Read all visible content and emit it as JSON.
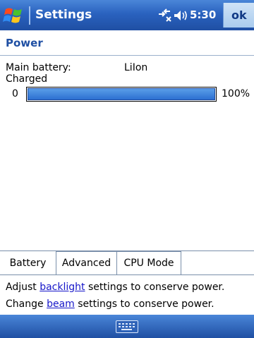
{
  "titlebar": {
    "title": "Settings",
    "time": "5:30",
    "ok": "ok"
  },
  "header": "Power",
  "battery": {
    "main_label": "Main battery:",
    "type": "LiIon",
    "status": "Charged",
    "min_label": "0",
    "max_label": "100%",
    "level_fraction": 1.0
  },
  "tabs": [
    {
      "label": "Battery"
    },
    {
      "label": "Advanced"
    },
    {
      "label": "CPU Mode"
    }
  ],
  "help": {
    "line1_prefix": "Adjust ",
    "line1_link": "backlight",
    "line1_suffix": " settings to conserve power.",
    "line2_prefix": "Change ",
    "line2_link": "beam",
    "line2_suffix": " settings to conserve power."
  },
  "icons": {
    "start": "windows-flag-icon",
    "connectivity": "connectivity-icon",
    "volume": "volume-icon",
    "keyboard": "keyboard-icon"
  },
  "colors": {
    "titlebar": "#2a62bf",
    "accent": "#1f4fa3",
    "bar_fill": "#2c6fd1"
  }
}
